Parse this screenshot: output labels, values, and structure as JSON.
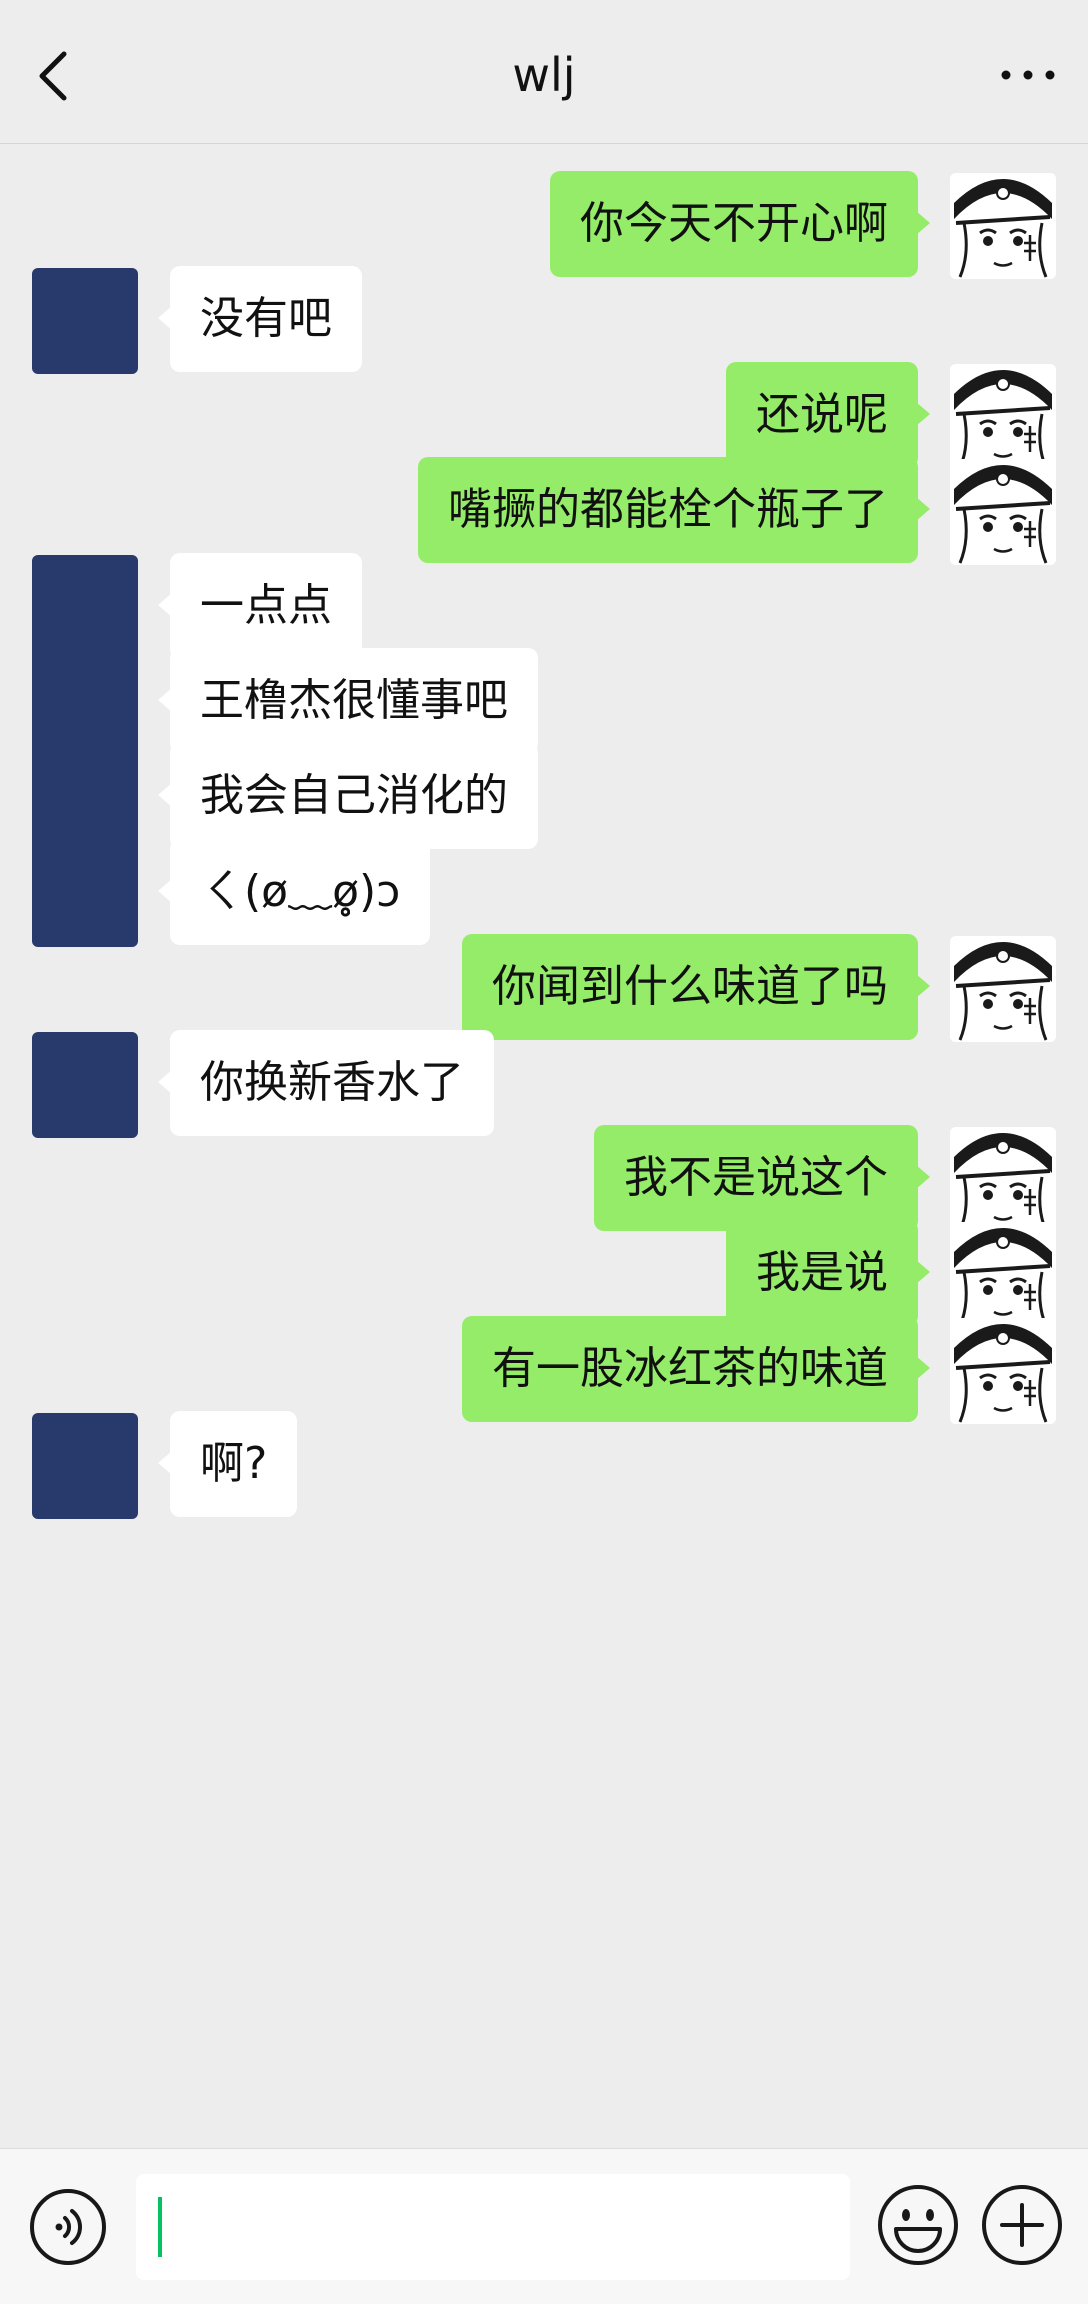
{
  "header": {
    "title": "wlj",
    "back_icon": "chevron-left-icon",
    "more_icon": "more-dots-icon"
  },
  "colors": {
    "background": "#ededed",
    "sent_bubble": "#95ec69",
    "received_bubble": "#ffffff",
    "contact_avatar": "#283a6b",
    "cursor": "#07c160"
  },
  "messages": [
    {
      "side": "right",
      "text": "你今天不开心啊"
    },
    {
      "side": "left",
      "text": "没有吧"
    },
    {
      "side": "right",
      "text": "还说呢"
    },
    {
      "side": "right",
      "text": "嘴撅的都能栓个瓶子了"
    },
    {
      "side": "left",
      "text": "一点点"
    },
    {
      "side": "left",
      "text": "王橹杰很懂事吧"
    },
    {
      "side": "left",
      "text": "我会自己消化的"
    },
    {
      "side": "left",
      "text": "ㄑ(ø﹏ø̥̥̥)ɔ"
    },
    {
      "side": "right",
      "text": "你闻到什么味道了吗"
    },
    {
      "side": "left",
      "text": "你换新香水了"
    },
    {
      "side": "right",
      "text": "我不是说这个"
    },
    {
      "side": "right",
      "text": "我是说"
    },
    {
      "side": "right",
      "text": "有一股冰红茶的味道"
    },
    {
      "side": "left",
      "text": "啊?"
    }
  ],
  "footer": {
    "input_value": "",
    "voice_icon": "voice-icon",
    "emoji_icon": "emoji-icon",
    "plus_icon": "plus-icon"
  }
}
